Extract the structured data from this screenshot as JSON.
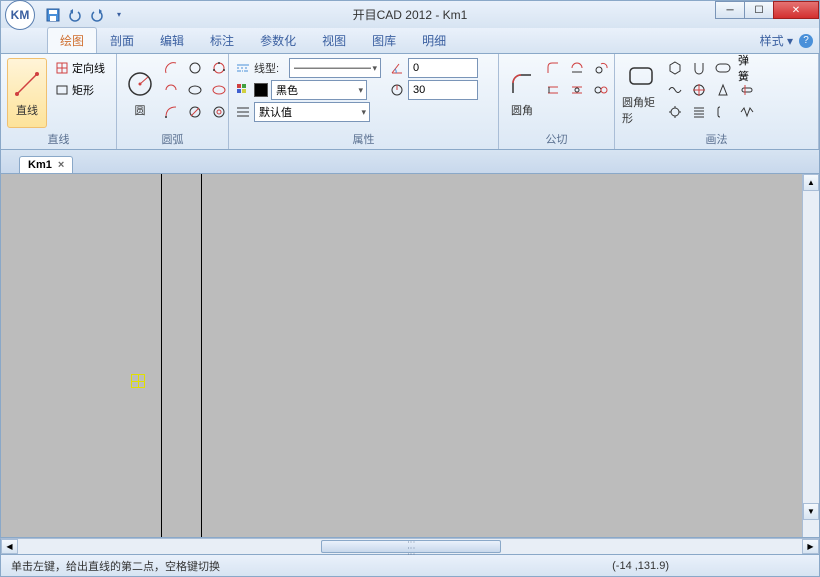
{
  "window": {
    "title": "开目CAD 2012 - Km1",
    "app_icon_text": "KM"
  },
  "qat": {
    "save": "save-icon",
    "undo": "undo-icon",
    "redo": "redo-icon"
  },
  "menu": {
    "tabs": [
      "绘图",
      "剖面",
      "编辑",
      "标注",
      "参数化",
      "视图",
      "图库",
      "明细"
    ],
    "active_index": 0,
    "style_label": "样式"
  },
  "ribbon": {
    "groups": {
      "line": {
        "label": "直线",
        "big_btn": "直线",
        "items": [
          "定向线",
          "矩形"
        ]
      },
      "arc": {
        "label": "圆弧",
        "big_btn": "圆"
      },
      "props": {
        "label": "属性",
        "linetype_label": "线型:",
        "linetype_value": "———————",
        "color_swatch": "#000000",
        "color_value": "黑色",
        "default_value": "默认值",
        "angle_value": "0",
        "length_value": "30"
      },
      "tangent": {
        "label": "公切",
        "big_btn": "圆角"
      },
      "draw": {
        "label": "画法",
        "big_btn": "圆角矩形",
        "spring": "弹簧"
      }
    }
  },
  "doc": {
    "tab_name": "Km1",
    "close": "×"
  },
  "status": {
    "hint": "单击左键，给出直线的第二点，空格键切换",
    "coords": "(-14 ,131.9)"
  }
}
